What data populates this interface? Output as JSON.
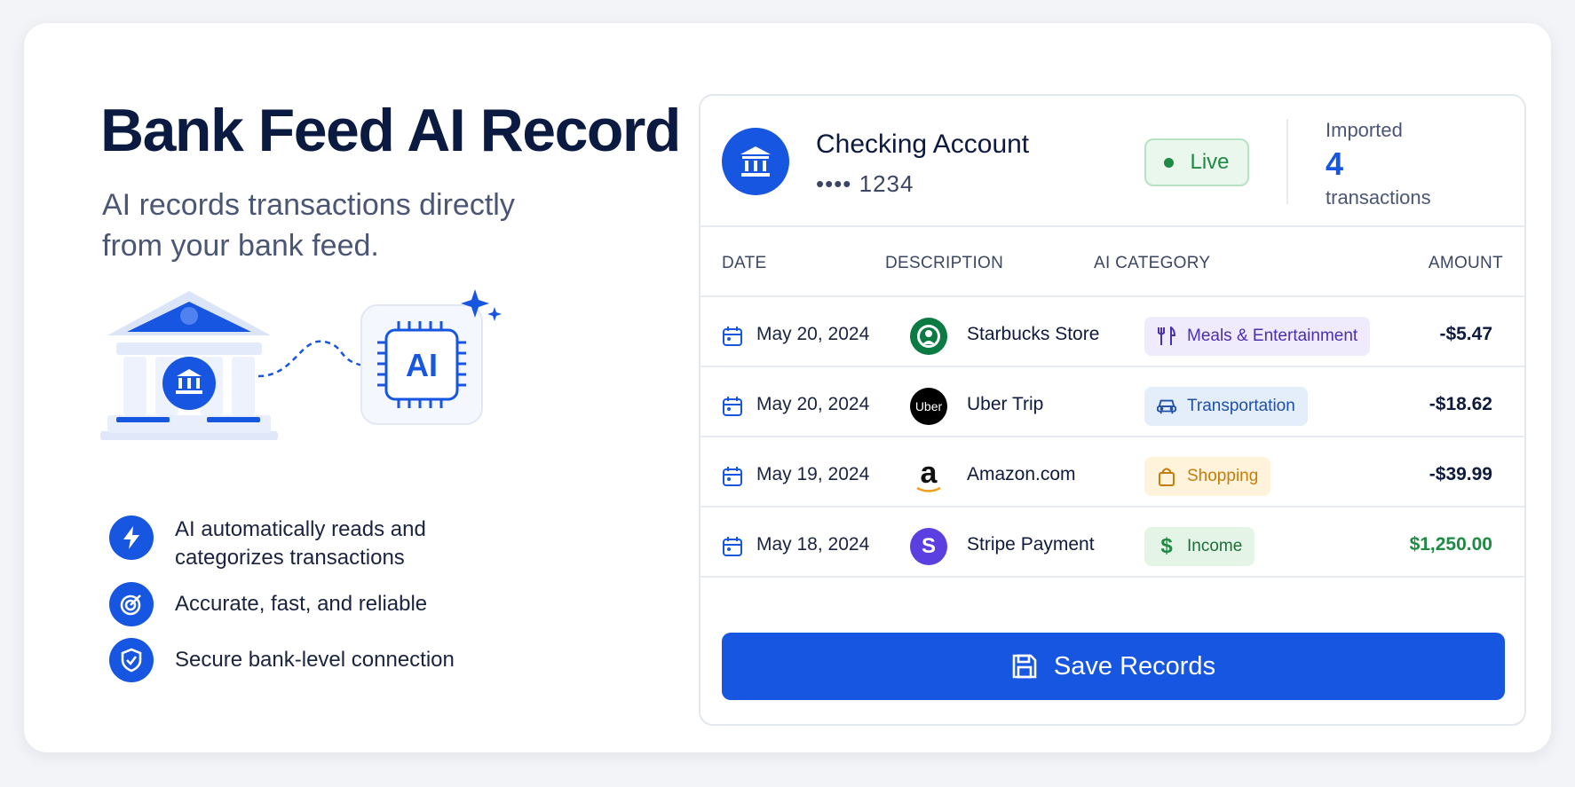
{
  "header": {
    "title": "Bank Feed AI Record",
    "subtitle": "AI records transactions directly from your bank feed."
  },
  "illustration": {
    "bank_icon": "bank-building-icon",
    "chip_icon": "ai-chip-icon",
    "chip_label": "AI",
    "sparkle_icon": "sparkle-icon"
  },
  "features": [
    {
      "icon": "lightning-icon",
      "text": "AI automatically reads and categorizes transactions"
    },
    {
      "icon": "target-icon",
      "text": "Accurate, fast, and reliable"
    },
    {
      "icon": "shield-check-icon",
      "text": "Secure bank-level connection"
    }
  ],
  "account": {
    "icon": "bank-icon",
    "name": "Checking Account",
    "number": "•••• 1234",
    "status": "Live",
    "imported_label": "Imported",
    "imported_count": "4",
    "imported_unit": "transactions"
  },
  "table": {
    "headers": {
      "date": "DATE",
      "description": "DESCRIPTION",
      "category": "AI CATEGORY",
      "amount": "AMOUNT"
    },
    "rows": [
      {
        "date": "May 20, 2024",
        "description": "Starbucks Store",
        "logo": "starbucks-logo",
        "category": "Meals & Entertainment",
        "category_icon": "utensils-icon",
        "amount": "-$5.47"
      },
      {
        "date": "May 20, 2024",
        "description": "Uber Trip",
        "logo": "uber-logo",
        "logo_text": "Uber",
        "category": "Transportation",
        "category_icon": "car-icon",
        "amount": "-$18.62"
      },
      {
        "date": "May 19, 2024",
        "description": "Amazon.com",
        "logo": "amazon-logo",
        "logo_text": "a",
        "category": "Shopping",
        "category_icon": "shopping-bag-icon",
        "amount": "-$39.99"
      },
      {
        "date": "May 18, 2024",
        "description": "Stripe Payment",
        "logo": "stripe-logo",
        "logo_text": "S",
        "category": "Income",
        "category_icon": "dollar-icon",
        "amount": "$1,250.00"
      }
    ]
  },
  "actions": {
    "save_label": "Save Records",
    "save_icon": "save-icon"
  },
  "colors": {
    "primary": "#1656e0",
    "live_green": "#1f8a44",
    "income_green": "#1f8a44",
    "meals_bg": "#efeafc",
    "meals_fg": "#4a2fb0",
    "transport_bg": "#e4eefb",
    "transport_fg": "#1f4fa8",
    "shopping_bg": "#fff3dc",
    "shopping_fg": "#c57d0a",
    "income_bg": "#e4f5e8"
  }
}
